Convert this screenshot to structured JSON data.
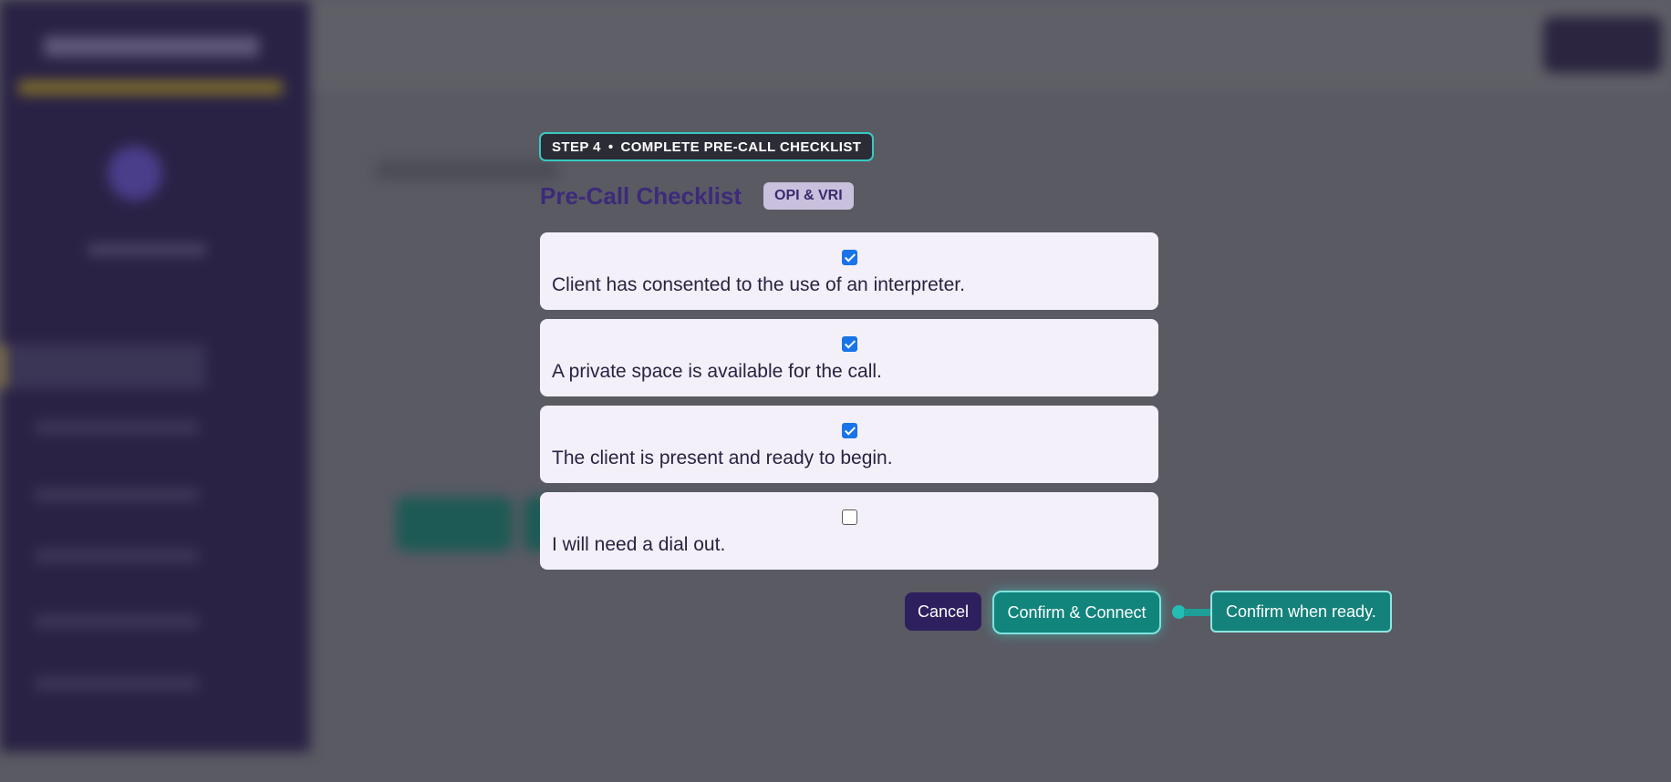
{
  "step_badge": {
    "step": "STEP 4",
    "separator": "•",
    "text": "COMPLETE PRE-CALL CHECKLIST"
  },
  "modal": {
    "title": "Pre-Call Checklist",
    "mode_pill": "OPI & VRI"
  },
  "checklist": [
    {
      "label": "Client has consented to the use of an interpreter.",
      "checked": true
    },
    {
      "label": "A private space is available for the call.",
      "checked": true
    },
    {
      "label": "The client is present and ready to begin.",
      "checked": true
    },
    {
      "label": "I will need a dial out.",
      "checked": false
    }
  ],
  "actions": {
    "cancel_label": "Cancel",
    "confirm_label": "Confirm & Connect"
  },
  "tooltip": {
    "text": "Confirm when ready."
  },
  "colors": {
    "accent_teal": "#11847c",
    "highlight_teal": "#37c9c2",
    "brand_purple": "#2e1f5e",
    "title_purple": "#3d2a7a",
    "checkbox_blue": "#1874e8"
  }
}
